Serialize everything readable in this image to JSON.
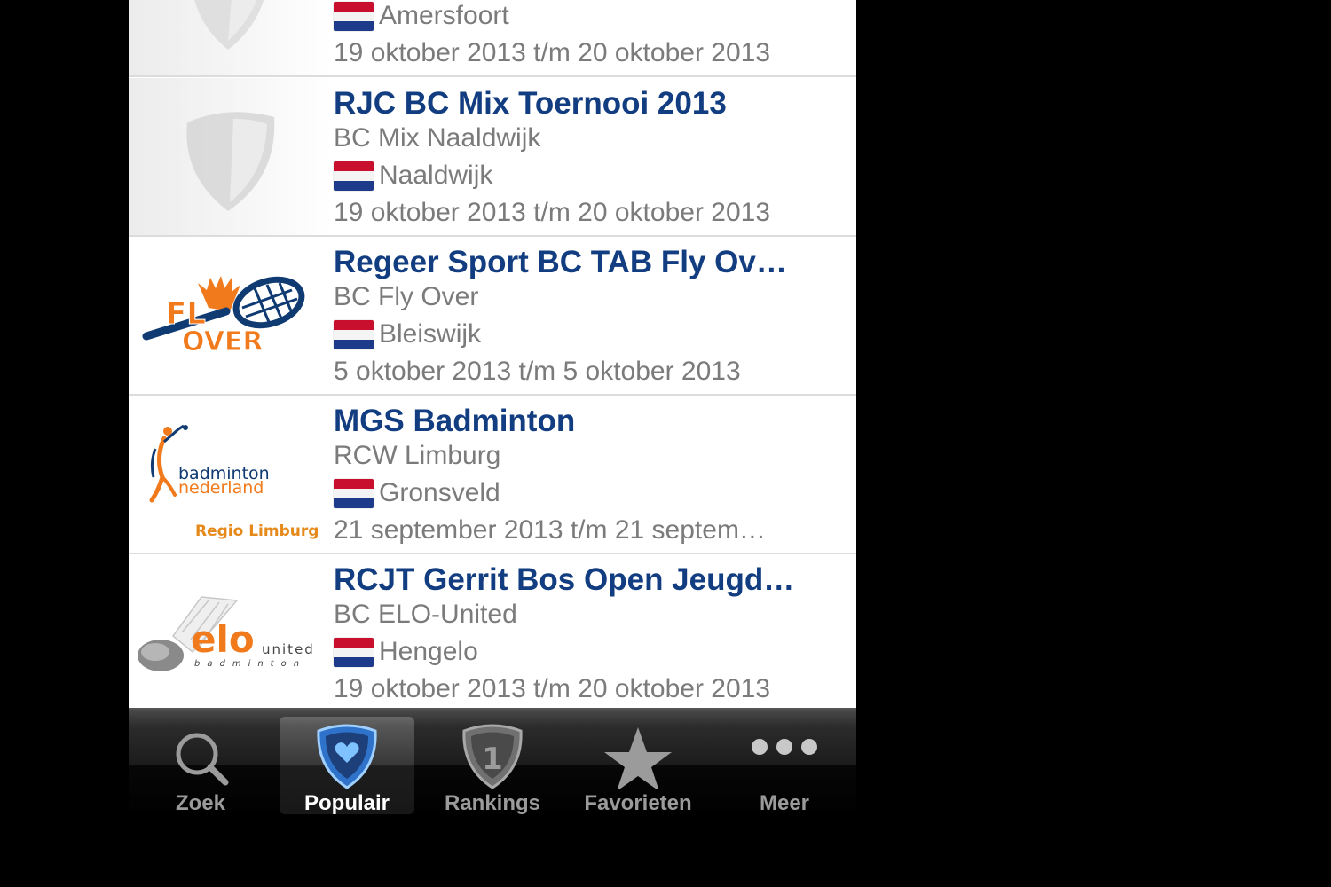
{
  "tournaments": [
    {
      "title": "",
      "org": "",
      "location": "Amersfoort",
      "dates": "19 oktober 2013 t/m 20 oktober 2013",
      "logo": "shield-placeholder-icon"
    },
    {
      "title": "RJC BC Mix Toernooi 2013",
      "org": "BC Mix Naaldwijk",
      "location": "Naaldwijk",
      "dates": "19 oktober 2013 t/m 20 oktober 2013",
      "logo": "shield-placeholder-icon"
    },
    {
      "title": "Regeer Sport BC TAB Fly Ov…",
      "org": "BC Fly Over",
      "location": "Bleiswijk",
      "dates": "5 oktober 2013 t/m 5 oktober 2013",
      "logo": "fly-over-logo"
    },
    {
      "title": "MGS Badminton",
      "org": "RCW Limburg",
      "location": "Gronsveld",
      "dates": "21 september 2013 t/m 21 septem…",
      "logo": "badminton-nederland-logo",
      "logo_text": [
        "badminton",
        "nederland",
        "Regio Limburg"
      ]
    },
    {
      "title": "RCJT Gerrit Bos Open Jeugd…",
      "org": "BC ELO-United",
      "location": "Hengelo",
      "dates": "19 oktober 2013 t/m 20 oktober 2013",
      "logo": "elo-united-logo",
      "logo_text": [
        "elo",
        "united",
        "badminton"
      ]
    }
  ],
  "tabbar": {
    "tabs": [
      {
        "label": "Zoek",
        "icon": "search-icon",
        "selected": false
      },
      {
        "label": "Populair",
        "icon": "heart-shield-icon",
        "selected": true
      },
      {
        "label": "Rankings",
        "icon": "ranking-shield-icon",
        "selected": false
      },
      {
        "label": "Favorieten",
        "icon": "star-icon",
        "selected": false
      },
      {
        "label": "Meer",
        "icon": "more-icon",
        "selected": false
      }
    ]
  },
  "colors": {
    "title": "#123d80",
    "secondary_text": "#7b7b7b",
    "selected_tab_accent": "#3b8de0",
    "fly_over_orange": "#f07a1c"
  }
}
